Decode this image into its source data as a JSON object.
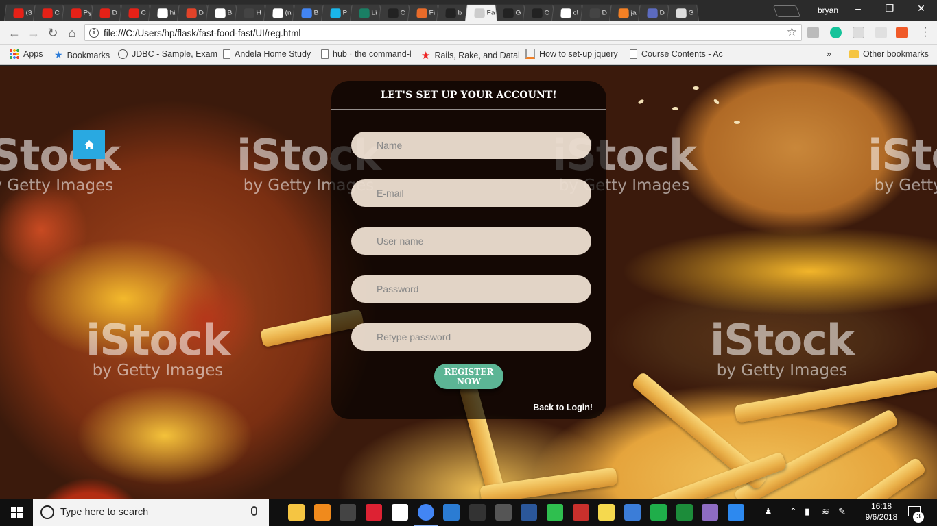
{
  "browser": {
    "tabs": [
      {
        "label": "(3",
        "icon": "youtube-icon",
        "color": "#e62117"
      },
      {
        "label": "C",
        "icon": "youtube-icon",
        "color": "#e62117"
      },
      {
        "label": "Py",
        "icon": "youtube-icon",
        "color": "#e62117"
      },
      {
        "label": "D",
        "icon": "youtube-icon",
        "color": "#e62117"
      },
      {
        "label": "C",
        "icon": "youtube-icon",
        "color": "#e62117"
      },
      {
        "label": "hi",
        "icon": "google-icon",
        "color": "#ffffff"
      },
      {
        "label": "D",
        "icon": "gitlab-icon",
        "color": "#e24329"
      },
      {
        "label": "B",
        "icon": "medium-icon",
        "color": "#ffffff"
      },
      {
        "label": "H",
        "icon": "page-icon",
        "color": "#444444"
      },
      {
        "label": "(n",
        "icon": "gmail-icon",
        "color": "#ffffff"
      },
      {
        "label": "B",
        "icon": "docs-icon",
        "color": "#4285f4"
      },
      {
        "label": "P",
        "icon": "vimeo-icon",
        "color": "#1ab7ea"
      },
      {
        "label": "Li",
        "icon": "pluralsight-icon",
        "color": "#1a7f64"
      },
      {
        "label": "C",
        "icon": "github-icon",
        "color": "#222222"
      },
      {
        "label": "Fi",
        "icon": "gear-icon",
        "color": "#e86b2a"
      },
      {
        "label": "b",
        "icon": "github-icon",
        "color": "#222222"
      },
      {
        "label": "Fa",
        "icon": "page-icon",
        "color": "#cccccc",
        "active": true
      },
      {
        "label": "G",
        "icon": "github-icon",
        "color": "#222222"
      },
      {
        "label": "C",
        "icon": "github-icon",
        "color": "#222222"
      },
      {
        "label": "cl",
        "icon": "google-icon",
        "color": "#ffffff"
      },
      {
        "label": "D",
        "icon": "page-icon",
        "color": "#444444"
      },
      {
        "label": "ja",
        "icon": "stackoverflow-icon",
        "color": "#f48024"
      },
      {
        "label": "D",
        "icon": "circle-icon",
        "color": "#5c6bc0"
      },
      {
        "label": "G",
        "icon": "square-icon",
        "color": "#dddddd"
      }
    ],
    "profile_name": "bryan",
    "url": "file:///C:/Users/hp/flask/fast-food-fast/UI/reg.html",
    "bookmarks": [
      {
        "label": "Apps",
        "icon": "apps-grid-icon"
      },
      {
        "label": "Bookmarks",
        "icon": "star-icon"
      },
      {
        "label": "JDBC - Sample, Exam",
        "icon": "globe-icon"
      },
      {
        "label": "Andela Home Study",
        "icon": "file-icon"
      },
      {
        "label": "hub · the command-l",
        "icon": "file-icon"
      },
      {
        "label": "Rails, Rake, and Datal",
        "icon": "red-star-icon"
      },
      {
        "label": "How to set-up jquery",
        "icon": "stackoverflow-icon"
      },
      {
        "label": "Course Contents - Ac",
        "icon": "file-icon"
      }
    ],
    "bookmarks_overflow": "»",
    "other_bookmarks": "Other bookmarks"
  },
  "page": {
    "home_icon": "home-icon",
    "title": "LET'S SET UP YOUR ACCOUNT!",
    "fields": [
      {
        "placeholder": "Name",
        "type": "text"
      },
      {
        "placeholder": "E-mail",
        "type": "email"
      },
      {
        "placeholder": "User name",
        "type": "text"
      },
      {
        "placeholder": "Password",
        "type": "password"
      },
      {
        "placeholder": "Retype password",
        "type": "password"
      }
    ],
    "register_label": "REGISTER NOW",
    "back_link": "Back to Login!",
    "watermark": {
      "brand": "iStock",
      "sub": "by Getty Images"
    },
    "accent_color": "#29a9e1",
    "button_color": "#5cb595"
  },
  "taskbar": {
    "search_placeholder": "Type here to search",
    "time": "16:18",
    "date": "9/6/2018",
    "notification_count": "3",
    "apps": [
      "file-explorer-icon",
      "vlc-icon",
      "terminal-icon",
      "bowling-app-icon",
      "notes-icon",
      "chrome-icon",
      "vscode-icon",
      "terminal-icon",
      "slack-icon",
      "word-icon",
      "refresh-app-icon",
      "filezilla-icon",
      "emoji-icon",
      "remote-desktop-icon",
      "green-circle-icon",
      "plus-app-icon",
      "paint-icon",
      "help-icon"
    ]
  }
}
